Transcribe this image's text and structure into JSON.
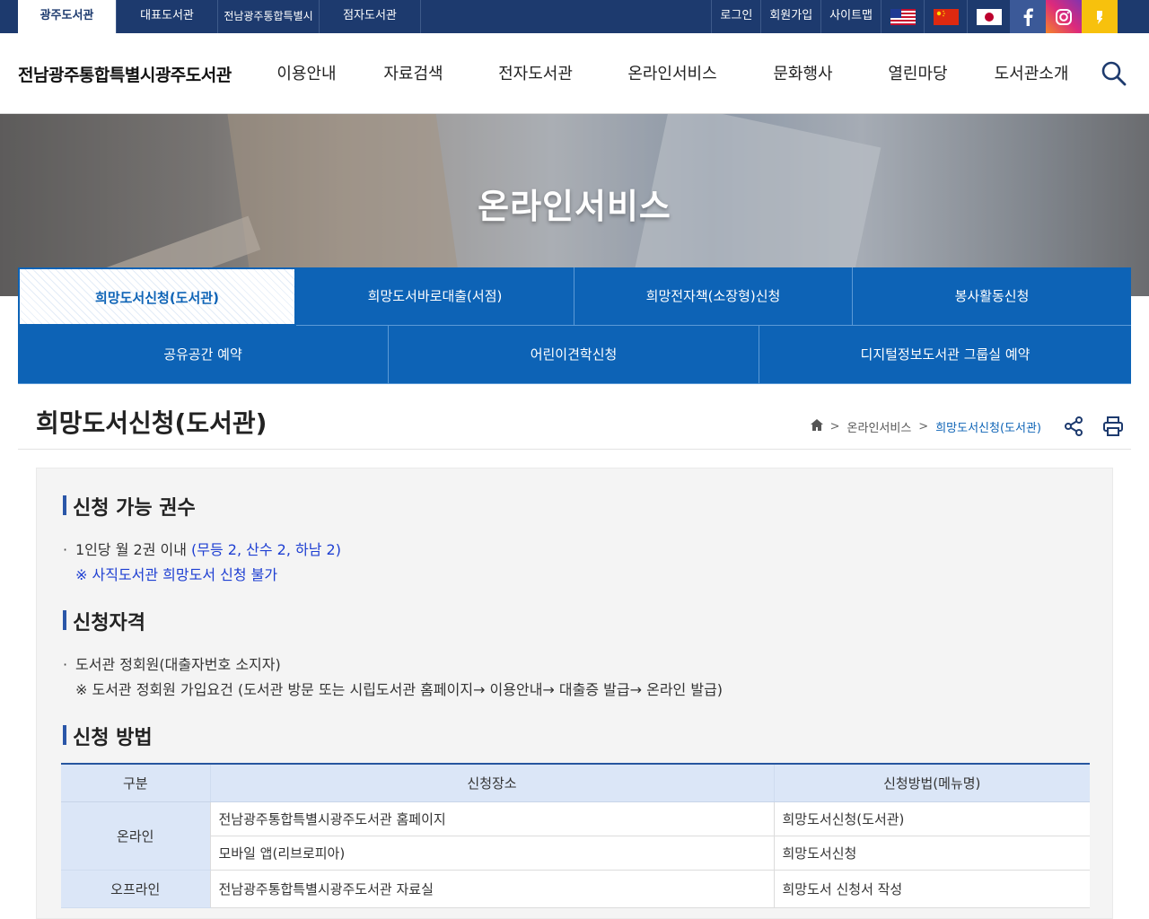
{
  "topbar": {
    "sites": [
      {
        "label": "광주도서관",
        "active": true
      },
      {
        "label": "대표도서관"
      },
      {
        "label": "전남광주통합특별시"
      },
      {
        "label": "점자도서관"
      }
    ],
    "util": [
      "로그인",
      "회원가입",
      "사이트맵"
    ]
  },
  "header": {
    "logo": "전남광주통합특별시광주도서관",
    "menu": [
      "이용안내",
      "자료검색",
      "전자도서관",
      "온라인서비스",
      "문화행사",
      "열린마당",
      "도서관소개"
    ]
  },
  "hero": {
    "title": "온라인서비스"
  },
  "tabs": {
    "row1": [
      "희망도서신청(도서관)",
      "희망도서바로대출(서점)",
      "희망전자책(소장형)신청",
      "봉사활동신청"
    ],
    "row2": [
      "공유공간 예약",
      "어린이견학신청",
      "디지털정보도서관 그룹실 예약"
    ]
  },
  "page": {
    "title": "희망도서신청(도서관)",
    "breadcrumb": [
      "온라인서비스",
      "희망도서신청(도서관)"
    ]
  },
  "sections": {
    "s1": {
      "title": "신청 가능 권수",
      "line1": "1인당 월 2권 이내",
      "line1_blue": "(무등 2, 산수 2, 하남 2)",
      "line2": "※ 사직도서관 희망도서 신청 불가"
    },
    "s2": {
      "title": "신청자격",
      "line1": "도서관 정회원(대출자번호 소지자)",
      "line2": "※ 도서관 정회원 가입요건 (도서관 방문 또는 시립도서관 홈페이지→ 이용안내→ 대출증 발급→ 온라인 발급)"
    },
    "s3": {
      "title": "신청 방법"
    }
  },
  "table": {
    "headers": [
      "구분",
      "신청장소",
      "신청방법(메뉴명)"
    ],
    "online": "온라인",
    "offline": "오프라인",
    "rows": [
      {
        "place": "전남광주통합특별시광주도서관 홈페이지",
        "method": "희망도서신청(도서관)"
      },
      {
        "place": "모바일 앱(리브로피아)",
        "method": "희망도서신청"
      },
      {
        "place": "전남광주통합특별시광주도서관 자료실",
        "method": "희망도서 신청서 작성"
      }
    ]
  },
  "colors": {
    "navy": "#1d3a6e",
    "tab_blue": "#0d63b6",
    "accent_blue": "#1e3fd2"
  }
}
